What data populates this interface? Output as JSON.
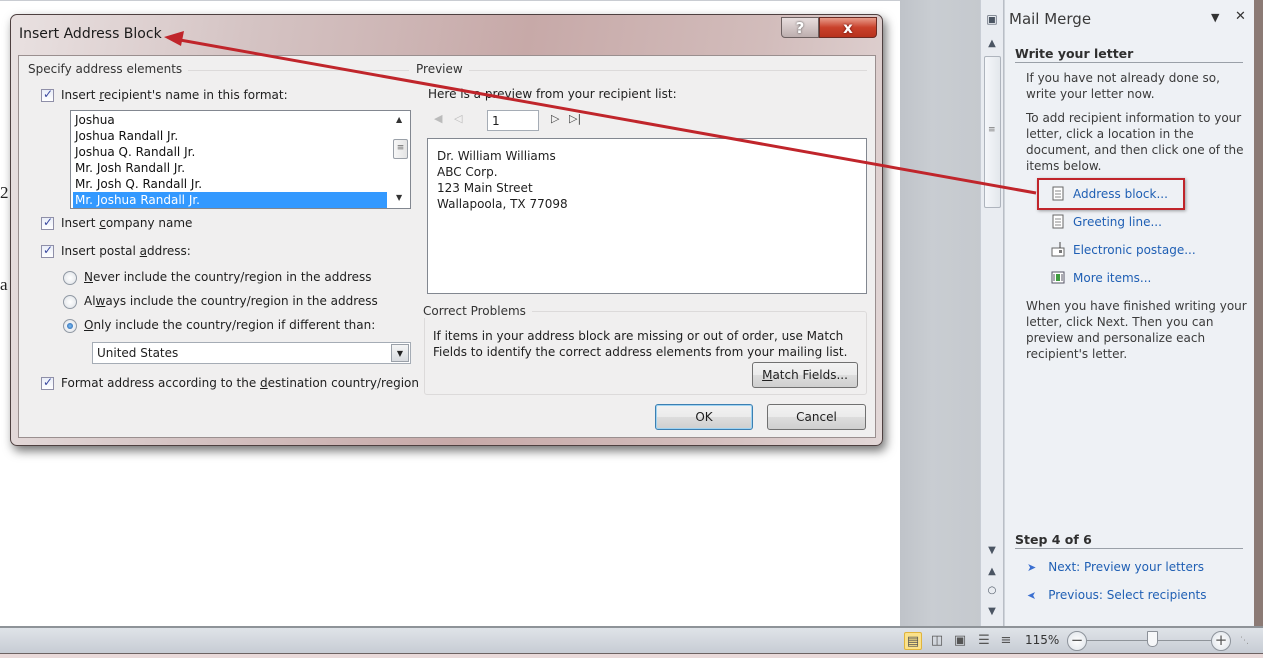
{
  "document": {
    "fragments": [
      "2",
      "a"
    ]
  },
  "dialog": {
    "title": "Insert Address Block",
    "help_label": "?",
    "close_label": "x",
    "specify_group_label": "Specify address elements",
    "insert_name_checkbox": {
      "label_pre": "Insert ",
      "label_accel": "r",
      "label_post": "ecipient's name in this format:",
      "checked": true
    },
    "name_formats": [
      "Joshua",
      "Joshua Randall Jr.",
      "Joshua Q. Randall Jr.",
      "Mr. Josh Randall Jr.",
      "Mr. Josh Q. Randall Jr.",
      "Mr. Joshua Randall Jr."
    ],
    "selected_name_format": "Mr. Joshua Randall Jr.",
    "insert_company_checkbox": {
      "label_pre": "Insert ",
      "label_accel": "c",
      "label_post": "ompany name",
      "checked": true
    },
    "insert_postal_checkbox": {
      "label_pre": "Insert postal ",
      "label_accel": "a",
      "label_post": "ddress:",
      "checked": true
    },
    "country_options": {
      "never": {
        "label_accel": "N",
        "label_post": "ever include the country/region in the address",
        "selected": false
      },
      "always": {
        "label_pre": "Al",
        "label_accel": "w",
        "label_post": "ays include the country/region in the address",
        "selected": false
      },
      "only": {
        "label_accel": "O",
        "label_post": "nly include the country/region if different than:",
        "selected": true
      }
    },
    "country_value": "United States",
    "format_address_checkbox": {
      "label_pre": "Format address according to the ",
      "label_accel": "d",
      "label_post": "estination country/region",
      "checked": true
    },
    "preview_group_label": "Preview",
    "preview_intro": "Here is a preview from your recipient list:",
    "record_number": "1",
    "preview_lines": [
      "Dr. William Williams",
      "ABC Corp.",
      "123 Main Street",
      "Wallapoola, TX 77098"
    ],
    "correct_group_label": "Correct Problems",
    "correct_text": "If items in your address block are missing or out of order, use Match Fields to identify the correct address elements from your mailing list.",
    "match_fields": {
      "label_accel": "M",
      "label_post": "atch Fields..."
    },
    "ok_label": "OK",
    "cancel_label": "Cancel"
  },
  "task_pane": {
    "title": "Mail Merge",
    "section_heading": "Write your letter",
    "intro_text": "If you have not already done so, write your letter now.",
    "instruction_text": "To add recipient information to your letter, click a location in the document, and then click one of the items below.",
    "items": [
      {
        "label": "Address block...",
        "icon": "document-icon",
        "highlighted": true
      },
      {
        "label": "Greeting line...",
        "icon": "document-icon"
      },
      {
        "label": "Electronic postage...",
        "icon": "postage-icon"
      },
      {
        "label": "More items...",
        "icon": "more-items-icon"
      }
    ],
    "finish_text": "When you have finished writing your letter, click Next. Then you can preview and personalize each recipient's letter.",
    "step_label": "Step 4 of 6",
    "next_link": "Next: Preview your letters",
    "previous_link": "Previous: Select recipients"
  },
  "status_bar": {
    "views": [
      "print-layout",
      "full-screen-reading",
      "web-layout",
      "outline",
      "draft"
    ],
    "active_view": "print-layout",
    "zoom_level": "115%",
    "zoom_percent": 115
  },
  "annotation": {
    "arrow_color": "#c0252b"
  }
}
